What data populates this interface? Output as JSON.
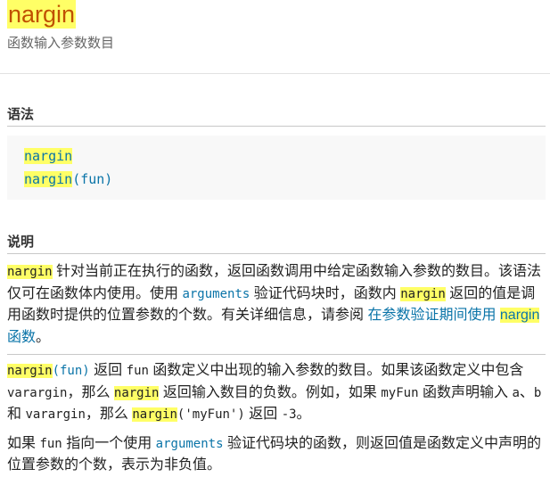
{
  "header": {
    "title": "nargin",
    "subtitle": "函数输入参数数目"
  },
  "syntax": {
    "heading": "语法",
    "lines": [
      [
        {
          "t": "nargin",
          "s": "hl"
        }
      ],
      [
        {
          "t": "nargin",
          "s": "hl"
        },
        {
          "t": "(fun)",
          "s": ""
        }
      ]
    ]
  },
  "description": {
    "heading": "说明",
    "paragraphs": [
      [
        {
          "t": "nargin",
          "s": "mono hl"
        },
        {
          "t": " 针对当前正在执行的函数，返回函数调用中给定函数输入参数的数目。该语法仅可在函数体内使用。使用 ",
          "s": ""
        },
        {
          "t": "arguments",
          "s": "mono link"
        },
        {
          "t": " 验证代码块时，函数内 ",
          "s": ""
        },
        {
          "t": "nargin",
          "s": "mono hl"
        },
        {
          "t": " 返回的值是调用函数时提供的位置参数的个数。有关详细信息，请参阅 ",
          "s": ""
        },
        {
          "t": "在参数验证期间使用 ",
          "s": "link"
        },
        {
          "t": "nargin",
          "s": "link hl"
        },
        {
          "t": " 函数",
          "s": "link"
        },
        {
          "t": "。",
          "s": ""
        }
      ],
      [
        {
          "t": "nargin",
          "s": "mono hl"
        },
        {
          "t": "(fun)",
          "s": "mono link"
        },
        {
          "t": " 返回 ",
          "s": ""
        },
        {
          "t": "fun",
          "s": "mono"
        },
        {
          "t": " 函数定义中出现的输入参数的数目。如果该函数定义中包含 ",
          "s": ""
        },
        {
          "t": "varargin",
          "s": "mono"
        },
        {
          "t": "，那么 ",
          "s": ""
        },
        {
          "t": "nargin",
          "s": "mono hl"
        },
        {
          "t": " 返回输入数目的负数。例如，如果 ",
          "s": ""
        },
        {
          "t": "myFun",
          "s": "mono"
        },
        {
          "t": " 函数声明输入 ",
          "s": ""
        },
        {
          "t": "a",
          "s": "mono"
        },
        {
          "t": "、",
          "s": ""
        },
        {
          "t": "b",
          "s": "mono"
        },
        {
          "t": " 和 ",
          "s": ""
        },
        {
          "t": "varargin",
          "s": "mono"
        },
        {
          "t": "，那么 ",
          "s": ""
        },
        {
          "t": "nargin",
          "s": "mono hl"
        },
        {
          "t": "('myFun')",
          "s": "mono"
        },
        {
          "t": " 返回 ",
          "s": ""
        },
        {
          "t": "-3",
          "s": "mono"
        },
        {
          "t": "。",
          "s": ""
        }
      ],
      [
        {
          "t": "如果 ",
          "s": ""
        },
        {
          "t": "fun",
          "s": "mono"
        },
        {
          "t": " 指向一个使用 ",
          "s": ""
        },
        {
          "t": "arguments",
          "s": "mono link"
        },
        {
          "t": " 验证代码块的函数，则返回值是函数定义中声明的位置参数的个数，表示为非负值。",
          "s": ""
        }
      ]
    ]
  }
}
